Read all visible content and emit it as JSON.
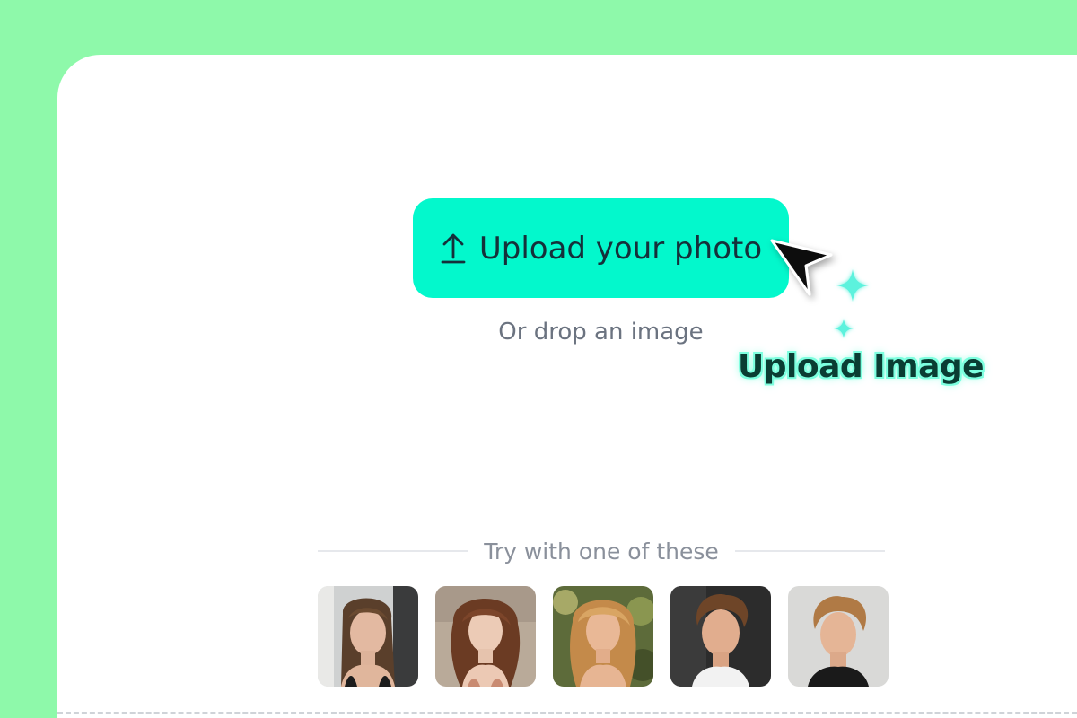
{
  "upload": {
    "button_label": "Upload your photo",
    "button_icon": "upload-arrow-icon",
    "drop_hint": "Or drop an image"
  },
  "annotation": {
    "label": "Upload Image"
  },
  "samples": {
    "heading": "Try with one of these",
    "items": [
      {
        "name": "sample-portrait-1"
      },
      {
        "name": "sample-portrait-2"
      },
      {
        "name": "sample-portrait-3"
      },
      {
        "name": "sample-portrait-4"
      },
      {
        "name": "sample-portrait-5"
      }
    ]
  },
  "colors": {
    "background": "#8ef9aa",
    "card": "#ffffff",
    "accent": "#03f8cc",
    "annotation_glow": "#7dffdf"
  }
}
